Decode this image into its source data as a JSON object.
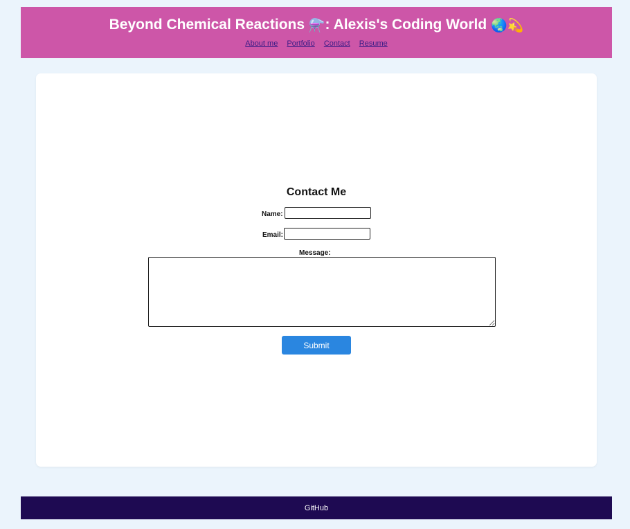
{
  "header": {
    "title_text_1": "Beyond Chemical Reactions ",
    "title_emoji_1": "⚗️",
    "title_text_2": ": Alexis's Coding World ",
    "title_emoji_2": "🌏💫",
    "background_color": "#cd56a8",
    "nav": [
      {
        "label": "About me"
      },
      {
        "label": "Portfolio"
      },
      {
        "label": "Contact"
      },
      {
        "label": "Resume"
      }
    ]
  },
  "contact": {
    "heading": "Contact Me",
    "name_label": "Name:",
    "name_value": "",
    "email_label": "Email:",
    "email_value": "",
    "message_label": "Message:",
    "message_value": "",
    "submit_label": "Submit",
    "submit_color": "#2a86e0"
  },
  "footer": {
    "link_label": "GitHub",
    "background_color": "#1e0a52"
  }
}
